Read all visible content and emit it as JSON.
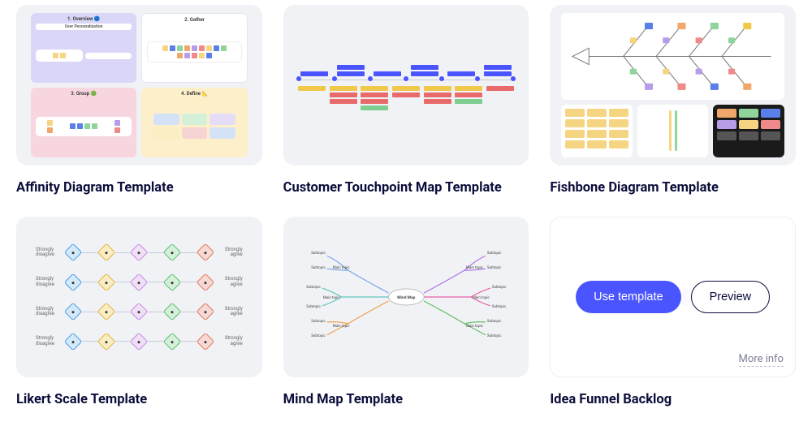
{
  "templates": [
    {
      "id": "affinity",
      "title": "Affinity Diagram Template"
    },
    {
      "id": "touchpoint",
      "title": "Customer Touchpoint Map Template"
    },
    {
      "id": "fishbone",
      "title": "Fishbone Diagram Template"
    },
    {
      "id": "likert",
      "title": "Likert Scale Template"
    },
    {
      "id": "mindmap",
      "title": "Mind Map Template"
    },
    {
      "id": "ideafunnel",
      "title": "Idea Funnel Backlog"
    }
  ],
  "affinity_panels": {
    "p1": "1. Overview 🔵",
    "p2": "2. Gather",
    "p3": "3. Group 🟢",
    "p4": "4. Define 📐",
    "header": "User Personalization"
  },
  "likert_labels": {
    "left": "Strongly disagree",
    "right": "Strongly agree"
  },
  "hover": {
    "use_label": "Use template",
    "preview_label": "Preview",
    "more_info_label": "More info"
  },
  "colors": {
    "primary": "#4a55ff",
    "text_dark": "#0b0d3a",
    "panel_bg": "#f1f2f5"
  }
}
